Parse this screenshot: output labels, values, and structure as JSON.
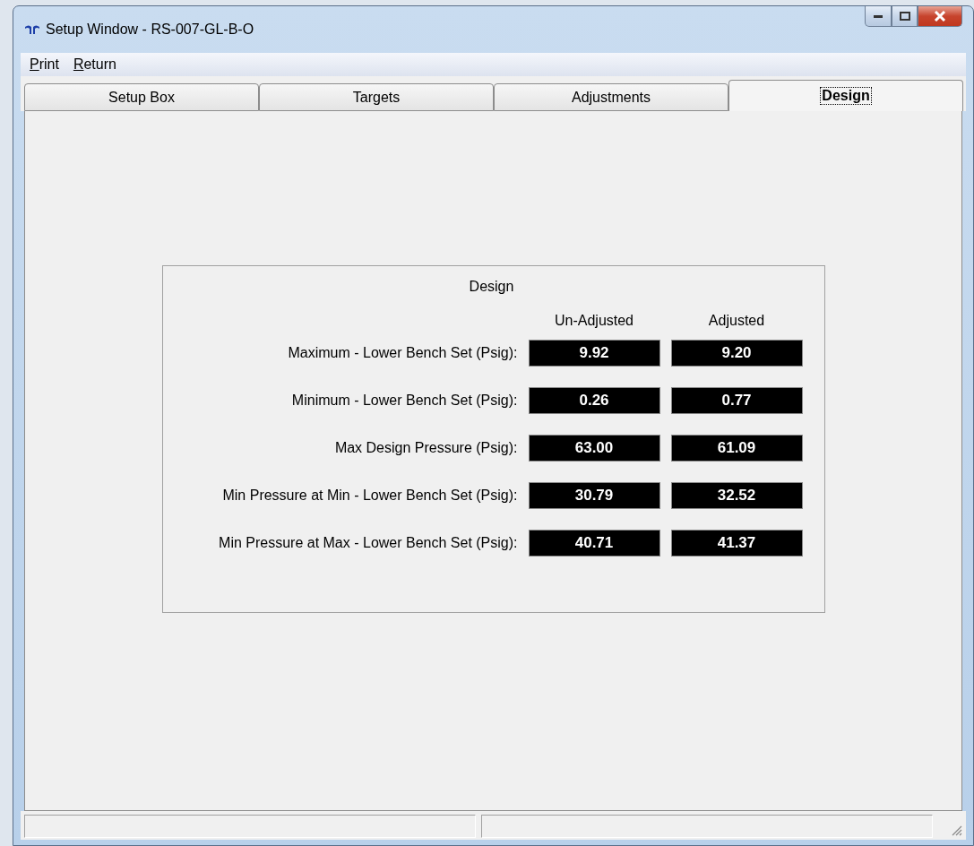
{
  "window": {
    "title": "Setup Window - RS-007-GL-B-O"
  },
  "menu": [
    {
      "label": "Print"
    },
    {
      "label": "Return"
    }
  ],
  "tabs": [
    {
      "label": "Setup Box",
      "selected": false
    },
    {
      "label": "Targets",
      "selected": false
    },
    {
      "label": "Adjustments",
      "selected": false
    },
    {
      "label": "Design",
      "selected": true
    }
  ],
  "design": {
    "title": "Design",
    "columns": [
      "Un-Adjusted",
      "Adjusted"
    ],
    "rows": [
      {
        "label": "Maximum - Lower Bench Set (Psig):",
        "values": [
          "9.92",
          "9.20"
        ]
      },
      {
        "label": "Minimum - Lower Bench Set (Psig):",
        "values": [
          "0.26",
          "0.77"
        ]
      },
      {
        "label": "Max Design Pressure (Psig):",
        "values": [
          "63.00",
          "61.09"
        ]
      },
      {
        "label": "Min Pressure at Min - Lower Bench Set (Psig):",
        "values": [
          "30.79",
          "32.52"
        ]
      },
      {
        "label": "Min Pressure at Max - Lower Bench Set (Psig):",
        "values": [
          "40.71",
          "41.37"
        ]
      }
    ]
  }
}
